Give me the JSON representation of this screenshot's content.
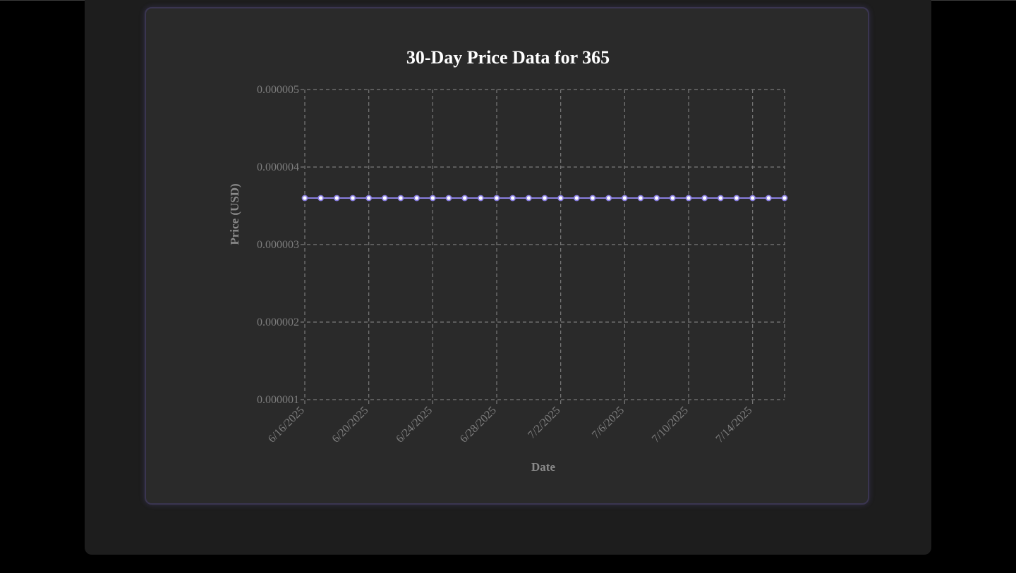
{
  "chart_data": {
    "type": "line",
    "title": "30-Day Price Data for 365",
    "xlabel": "Date",
    "ylabel": "Price (USD)",
    "ylim": [
      1e-06,
      5e-06
    ],
    "yticks": [
      "0.000001",
      "0.000002",
      "0.000003",
      "0.000004",
      "0.000005"
    ],
    "xtick_labels": [
      "6/16/2025",
      "6/20/2025",
      "6/24/2025",
      "6/28/2025",
      "7/2/2025",
      "7/6/2025",
      "7/10/2025",
      "7/14/2025"
    ],
    "x": [
      "6/16/2025",
      "6/17/2025",
      "6/18/2025",
      "6/19/2025",
      "6/20/2025",
      "6/21/2025",
      "6/22/2025",
      "6/23/2025",
      "6/24/2025",
      "6/25/2025",
      "6/26/2025",
      "6/27/2025",
      "6/28/2025",
      "6/29/2025",
      "6/30/2025",
      "7/1/2025",
      "7/2/2025",
      "7/3/2025",
      "7/4/2025",
      "7/5/2025",
      "7/6/2025",
      "7/7/2025",
      "7/8/2025",
      "7/9/2025",
      "7/10/2025",
      "7/11/2025",
      "7/12/2025",
      "7/13/2025",
      "7/14/2025",
      "7/15/2025",
      "7/16/2025"
    ],
    "series": [
      {
        "values": [
          3.6e-06,
          3.6e-06,
          3.6e-06,
          3.6e-06,
          3.6e-06,
          3.6e-06,
          3.6e-06,
          3.6e-06,
          3.6e-06,
          3.6e-06,
          3.6e-06,
          3.6e-06,
          3.6e-06,
          3.6e-06,
          3.6e-06,
          3.6e-06,
          3.6e-06,
          3.6e-06,
          3.6e-06,
          3.6e-06,
          3.6e-06,
          3.6e-06,
          3.6e-06,
          3.6e-06,
          3.6e-06,
          3.6e-06,
          3.6e-06,
          3.6e-06,
          3.6e-06,
          3.6e-06,
          3.6e-06
        ]
      }
    ],
    "grid": true,
    "legend": "none",
    "colors": {
      "line": "#8a7fe0",
      "point_fill": "#ffffff",
      "grid": "#7a7a7a"
    }
  }
}
